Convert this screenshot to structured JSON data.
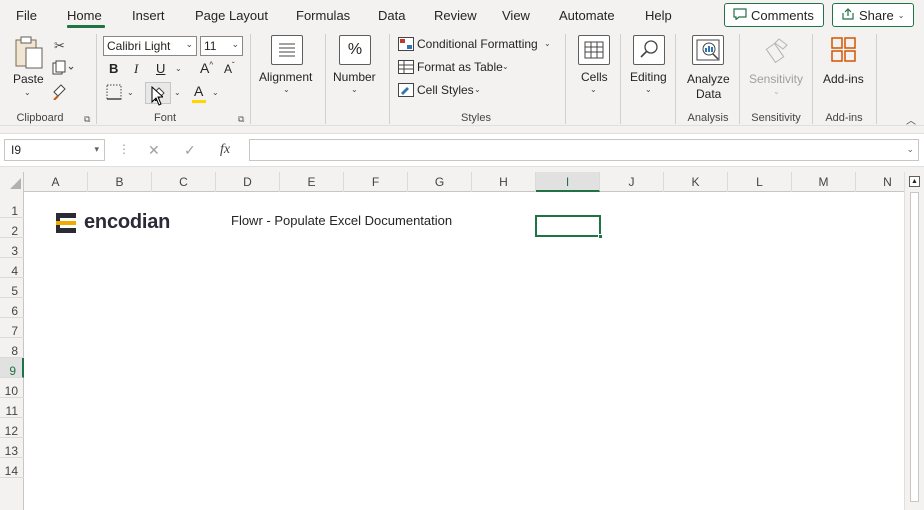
{
  "tabs": [
    {
      "label": "File",
      "active": false
    },
    {
      "label": "Home",
      "active": true
    },
    {
      "label": "Insert",
      "active": false
    },
    {
      "label": "Page Layout",
      "active": false
    },
    {
      "label": "Formulas",
      "active": false
    },
    {
      "label": "Data",
      "active": false
    },
    {
      "label": "Review",
      "active": false
    },
    {
      "label": "View",
      "active": false
    },
    {
      "label": "Automate",
      "active": false
    },
    {
      "label": "Help",
      "active": false
    }
  ],
  "top_buttons": {
    "comments": "Comments",
    "share": "Share"
  },
  "ribbon": {
    "clipboard": {
      "paste": "Paste",
      "label": "Clipboard"
    },
    "font": {
      "name": "Calibri Light",
      "size": "11",
      "bold": "B",
      "italic": "I",
      "underline": "U",
      "grow": "A",
      "shrink": "A",
      "color_letter": "A",
      "label": "Font"
    },
    "alignment": {
      "label": "Alignment"
    },
    "number": {
      "label": "Number",
      "symbol": "%"
    },
    "styles": {
      "conditional": "Conditional Formatting",
      "format_table": "Format as Table",
      "cell_styles": "Cell Styles",
      "label": "Styles"
    },
    "cells": {
      "label": "Cells"
    },
    "editing": {
      "label": "Editing"
    },
    "analysis": {
      "line1": "Analyze",
      "line2": "Data",
      "label": "Analysis"
    },
    "sensitivity": {
      "button": "Sensitivity",
      "label": "Sensitivity"
    },
    "addins": {
      "button": "Add-ins",
      "label": "Add-ins"
    }
  },
  "formula_bar": {
    "name_box": "I9",
    "fx": "fx",
    "value": ""
  },
  "columns": [
    "A",
    "B",
    "C",
    "D",
    "E",
    "F",
    "G",
    "H",
    "I",
    "J",
    "K",
    "L",
    "M",
    "N"
  ],
  "selected_column": "I",
  "rows": [
    "1",
    "2",
    "3",
    "4",
    "5",
    "6",
    "7",
    "8",
    "9",
    "10",
    "11",
    "12",
    "13",
    "14"
  ],
  "selected_row": "9",
  "sheet": {
    "logo_text": "encodian",
    "title": "Flowr - Populate Excel Documentation"
  },
  "colors": {
    "accent": "#217346",
    "logo_orange": "#f2a900",
    "logo_dark": "#2b2a37"
  }
}
